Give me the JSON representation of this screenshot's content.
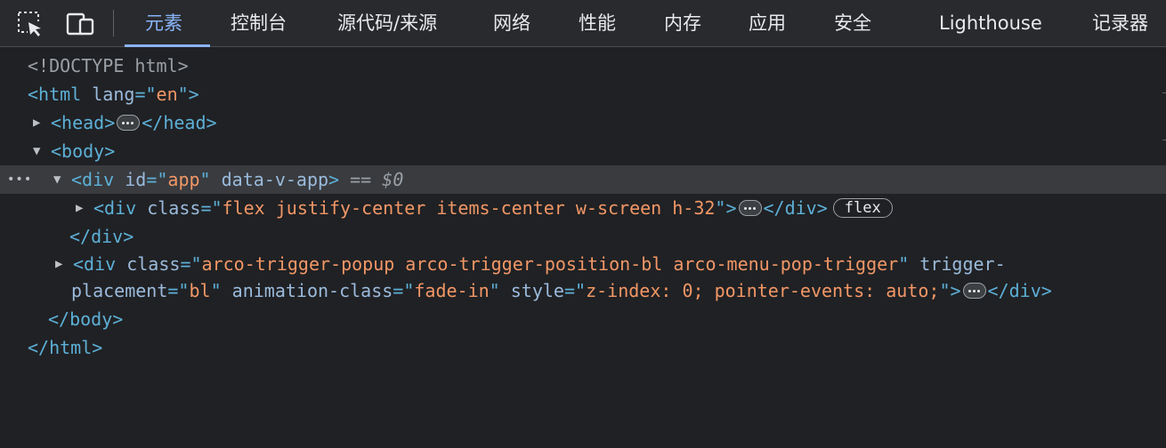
{
  "toolbar": {
    "inspect_icon": "inspect-element-icon",
    "device_icon": "device-toolbar-icon",
    "tabs": [
      {
        "label": "元素"
      },
      {
        "label": "控制台"
      },
      {
        "label": "源代码/来源"
      },
      {
        "label": "网络"
      },
      {
        "label": "性能"
      },
      {
        "label": "内存"
      },
      {
        "label": "应用"
      },
      {
        "label": "安全"
      },
      {
        "label": "Lighthouse"
      },
      {
        "label": "记录器"
      }
    ],
    "active_tab": "元素"
  },
  "dom": {
    "doctype": "<!DOCTYPE html>",
    "html_open": {
      "tag": "<html",
      "attr": "lang",
      "eq": "=\"",
      "val": "en",
      "close": "\">"
    },
    "head": {
      "open": "<head>",
      "close": "</head>"
    },
    "body_open": "<body>",
    "app_div": {
      "tag": "<div",
      "attr1": "id",
      "val1": "app",
      "attr2": "data-v-app",
      "close": ">",
      "marker": "==",
      "marker_var": "$0"
    },
    "flex_div": {
      "tag": "<div",
      "attr": "class",
      "val": "flex justify-center items-center w-screen h-32",
      "close": ">",
      "end": "</div>",
      "badge": "flex"
    },
    "app_div_close": "</div>",
    "popup_div": {
      "tag": "<div",
      "attr1": "class",
      "val1": "arco-trigger-popup arco-trigger-position-bl arco-menu-pop-trigger",
      "attr2a": "trigger-",
      "attr2b": "placement",
      "val2": "bl",
      "attr3": "animation-class",
      "val3": "fade-in",
      "attr4": "style",
      "val4": "z-index: 0; pointer-events: auto;",
      "close": ">",
      "end": "</div>"
    },
    "body_close": "</body>",
    "html_close": "</html>"
  }
}
